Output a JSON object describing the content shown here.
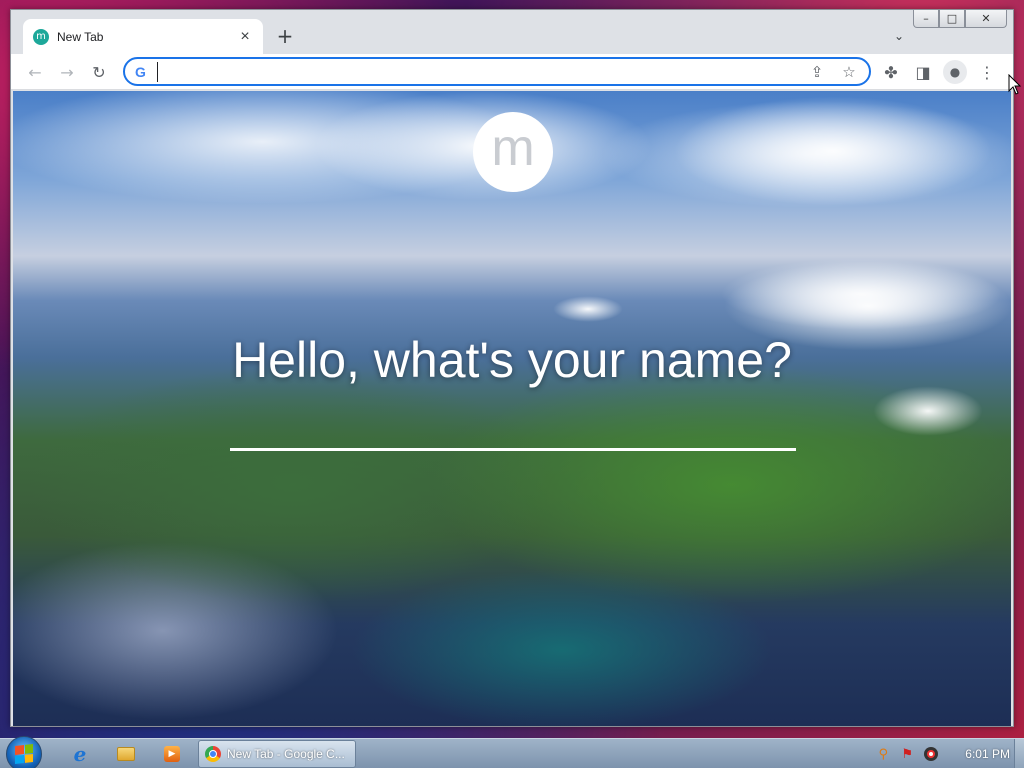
{
  "browser": {
    "tab": {
      "favicon_letter": "m",
      "title": "New Tab",
      "close_glyph": "×"
    },
    "new_tab_glyph": "+",
    "tab_search_glyph": "⌄",
    "caption": {
      "minimize": "–",
      "maximize": "□",
      "close": "✕"
    },
    "toolbar": {
      "back_glyph": "←",
      "forward_glyph": "→",
      "reload_glyph": "↻",
      "omnibox_value": "",
      "share_glyph": "⇪",
      "bookmark_glyph": "☆",
      "extensions_glyph": "✤",
      "sidepanel_glyph": "◨",
      "profile_glyph": "●",
      "menu_glyph": "⋮"
    }
  },
  "page": {
    "logo_letter": "m",
    "greeting": "Hello, what's your name?",
    "name_value": ""
  },
  "taskbar": {
    "task_label": "New Tab - Google C...",
    "clock": "6:01 PM"
  },
  "colors": {
    "accent_blue": "#1a73e8",
    "favicon_teal": "#1da89a"
  }
}
